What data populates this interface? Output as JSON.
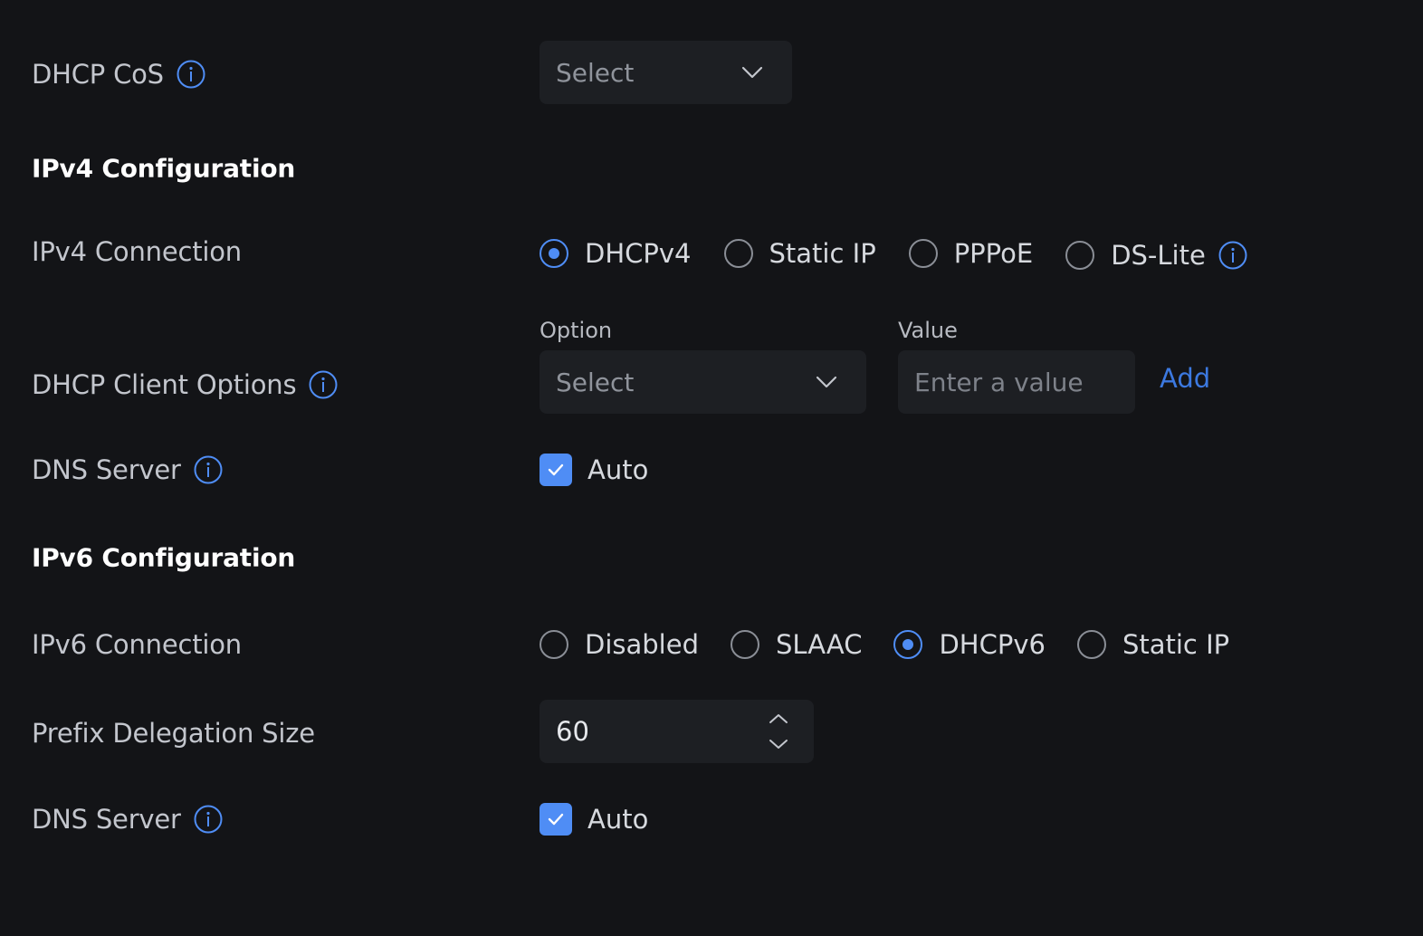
{
  "dhcp_cos": {
    "label": "DHCP CoS",
    "select_placeholder": "Select"
  },
  "ipv4": {
    "section_title": "IPv4 Configuration",
    "connection_label": "IPv4 Connection",
    "connection_options": [
      "DHCPv4",
      "Static IP",
      "PPPoE",
      "DS-Lite"
    ],
    "connection_selected": "DHCPv4",
    "client_options": {
      "label": "DHCP Client Options",
      "option_label": "Option",
      "option_placeholder": "Select",
      "value_label": "Value",
      "value_placeholder": "Enter a value",
      "add_label": "Add"
    },
    "dns": {
      "label": "DNS Server",
      "auto_label": "Auto",
      "auto_checked": true
    }
  },
  "ipv6": {
    "section_title": "IPv6 Configuration",
    "connection_label": "IPv6 Connection",
    "connection_options": [
      "Disabled",
      "SLAAC",
      "DHCPv6",
      "Static IP"
    ],
    "connection_selected": "DHCPv6",
    "prefix_delegation": {
      "label": "Prefix Delegation Size",
      "value": "60"
    },
    "dns": {
      "label": "DNS Server",
      "auto_label": "Auto",
      "auto_checked": true
    }
  },
  "colors": {
    "background": "#131417",
    "accent": "#4f8df5",
    "link": "#3c79e0",
    "field_bg": "#1d1f23"
  },
  "icons": {
    "info": "info-icon",
    "chevron": "chevron-down-icon",
    "check": "check-icon",
    "stepper_up": "chevron-up-icon",
    "stepper_down": "chevron-down-icon"
  }
}
